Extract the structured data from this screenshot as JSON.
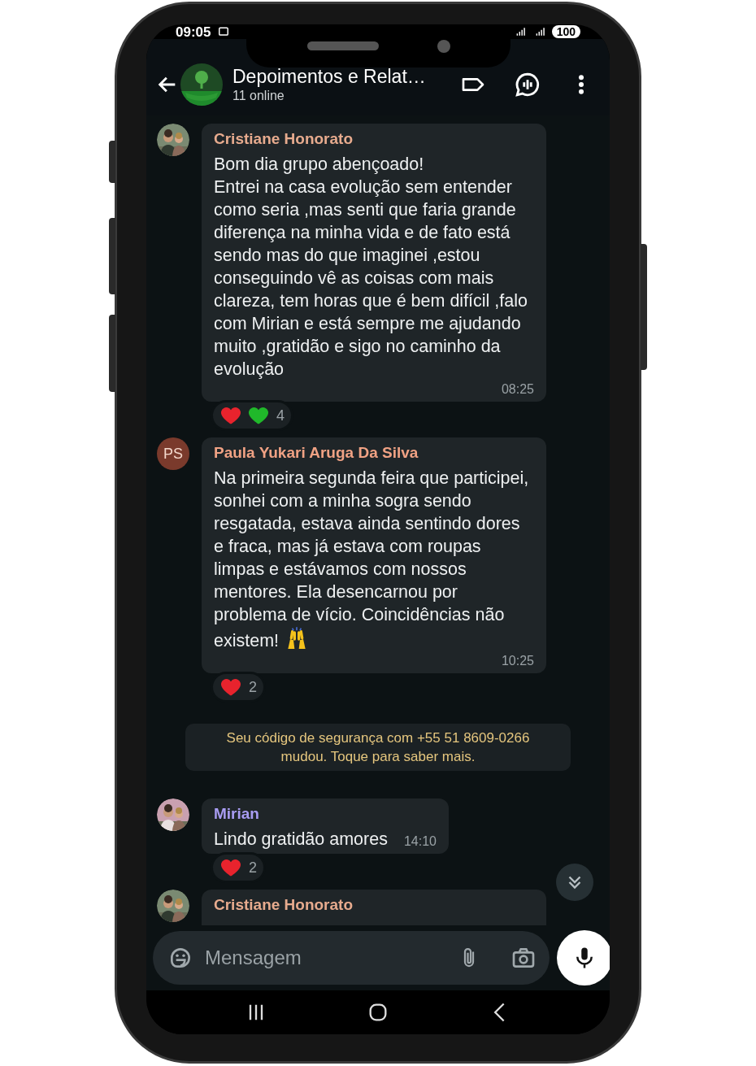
{
  "status_bar": {
    "time": "09:05",
    "battery": "100"
  },
  "header": {
    "title": "Depoimentos e Relat…",
    "subtitle": "11 online"
  },
  "messages": [
    {
      "kind": "message",
      "sender": "Cristiane Honorato",
      "color": "#e7ab8e",
      "text": "Bom dia grupo abençoado!\nEntrei na casa evolução sem entender como seria ,mas senti que faria grande diferença na minha vida e de fato está sendo mas do que imaginei ,estou conseguindo vê as coisas com mais clareza, tem horas que é bem difícil ,falo com Mirian e está sempre me ajudando muito ,gratidão e sigo no caminho da evolução",
      "emoji": false,
      "time": "08:25",
      "reactions": {
        "hearts": [
          {
            "color": "#e8232d"
          },
          {
            "color": "#20b82a"
          }
        ],
        "count": "4"
      }
    },
    {
      "kind": "message",
      "sender": "Paula Yukari Aruga Da Silva",
      "color": "#f0a284",
      "avatar": {
        "kind": "initials",
        "text": "PS",
        "color": "#7a3a2c"
      },
      "text": "Na primeira segunda feira que participei, sonhei com a minha sogra sendo resgatada, estava ainda sentindo dores e fraca, mas já estava com roupas limpas e estávamos com nossos mentores. Ela desencarnou por problema de vício. Coincidências não existem!",
      "emoji": true,
      "time": "10:25",
      "reactions": {
        "hearts": [
          {
            "color": "#e8232d"
          }
        ],
        "count": "2"
      }
    },
    {
      "kind": "system",
      "text": "Seu código de segurança com +55 51 8609-0266 mudou. Toque para saber mais."
    },
    {
      "kind": "message",
      "sender": "Mirian",
      "color": "#a89cf2",
      "text": "Lindo gratidão amores",
      "emoji": false,
      "time": "14:10",
      "reactions": {
        "hearts": [
          {
            "color": "#e8232d"
          }
        ],
        "count": "2"
      }
    },
    {
      "kind": "message",
      "sender": "Cristiane Honorato",
      "color": "#e7ab8e"
    }
  ],
  "composer": {
    "placeholder": "Mensagem"
  }
}
